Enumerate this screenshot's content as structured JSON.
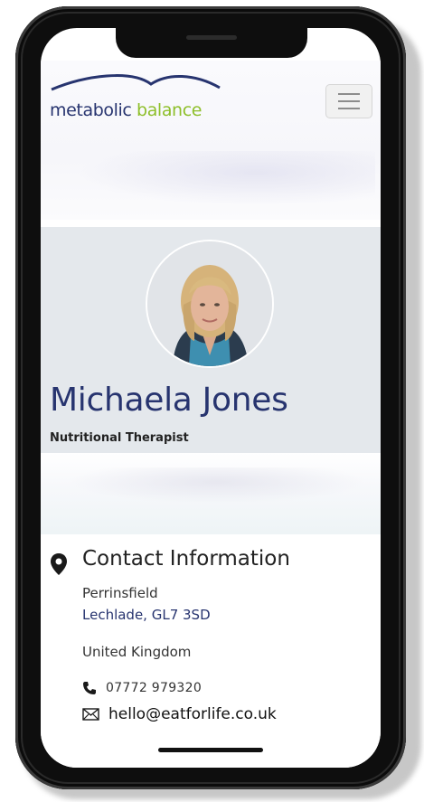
{
  "brand": {
    "logo_word1": "metabolic",
    "logo_word2": "balance",
    "colors": {
      "navy": "#27346f",
      "green": "#8ebf2a"
    }
  },
  "header": {
    "menu_icon": "hamburger-icon"
  },
  "profile": {
    "name": "Michaela Jones",
    "role": "Nutritional Therapist"
  },
  "contact": {
    "title": "Contact Information",
    "address_line1": "Perrinsfield",
    "address_city": "Lechlade, GL7 3SD",
    "country": "United Kingdom",
    "phone": "07772 979320",
    "email": "hello@eatforlife.co.uk"
  }
}
